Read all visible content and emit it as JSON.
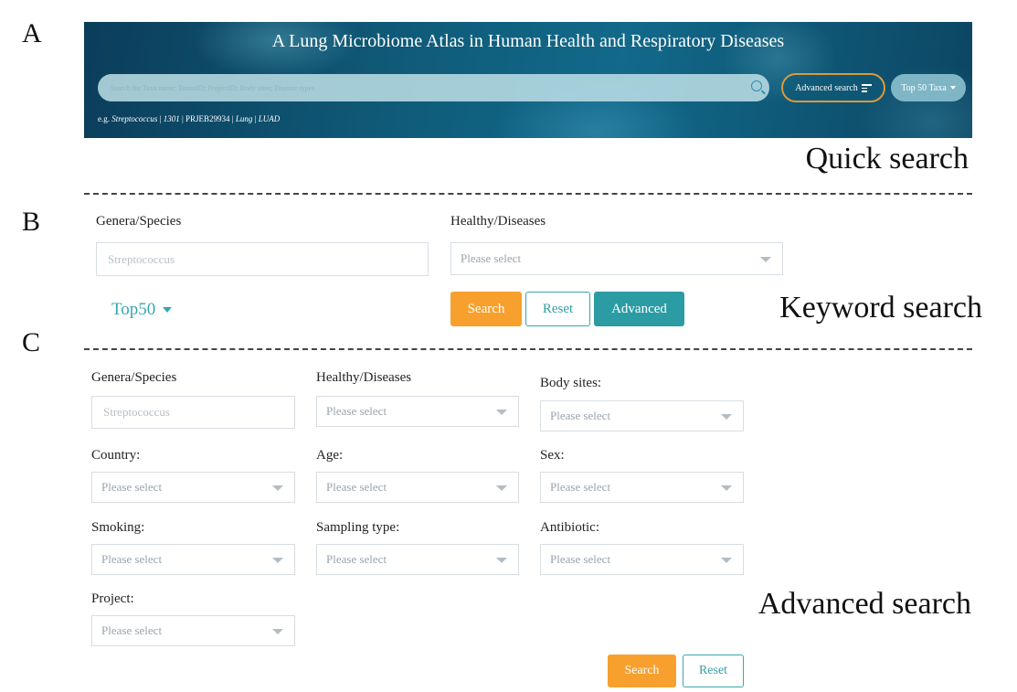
{
  "panel_letters": {
    "a": "A",
    "b": "B",
    "c": "C"
  },
  "section_captions": {
    "quick": "Quick search",
    "keyword": "Keyword search",
    "advanced": "Advanced search"
  },
  "banner": {
    "title": "A Lung Microbiome Atlas in Human Health and Respiratory Diseases",
    "search_placeholder": "Search for Taxa name; TaxonID; ProjectID; Body sites; Disease types",
    "advanced_button": "Advanced search",
    "top50_button": "Top 50 Taxa",
    "examples": {
      "prefix": "e.g.",
      "taxa": "Streptococcus",
      "sep1": "|",
      "taxon_id": "1301",
      "sep2": "|",
      "project": "PRJEB29934",
      "sep3": "|",
      "body_site": "Lung",
      "sep4": "|",
      "disease": "LUAD"
    }
  },
  "keyword_search": {
    "genera_label": "Genera/Species",
    "genera_placeholder": "Streptococcus",
    "disease_label": "Healthy/Diseases",
    "disease_placeholder": "Please select",
    "top50_link": "Top50",
    "search_button": "Search",
    "reset_button": "Reset",
    "advanced_button": "Advanced"
  },
  "advanced_search": {
    "genera_label": "Genera/Species",
    "genera_placeholder": "Streptococcus",
    "disease_label": "Healthy/Diseases",
    "body_sites_label": "Body sites:",
    "country_label": "Country:",
    "age_label": "Age:",
    "sex_label": "Sex:",
    "smoking_label": "Smoking:",
    "sampling_label": "Sampling type:",
    "antibiotic_label": "Antibiotic:",
    "project_label": "Project:",
    "select_placeholder": "Please select",
    "search_button": "Search",
    "reset_button": "Reset"
  },
  "colors": {
    "accent_orange": "#f7a02e",
    "accent_teal": "#2c9ca4",
    "banner_dark": "#0f5a78"
  }
}
